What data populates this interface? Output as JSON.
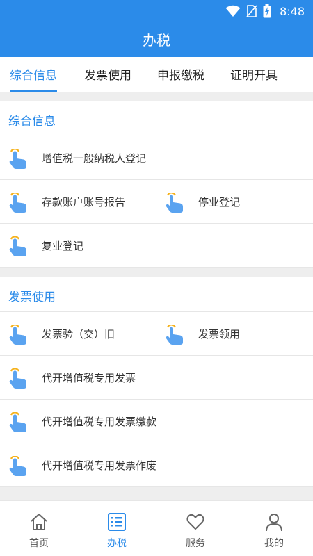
{
  "status": {
    "time": "8:48"
  },
  "header": {
    "title": "办税"
  },
  "tabs": [
    {
      "label": "综合信息",
      "active": true
    },
    {
      "label": "发票使用",
      "active": false
    },
    {
      "label": "申报缴税",
      "active": false
    },
    {
      "label": "证明开具",
      "active": false
    }
  ],
  "sections": [
    {
      "title": "综合信息",
      "items": [
        {
          "label": "增值税一般纳税人登记"
        },
        {
          "label": "存款账户账号报告"
        },
        {
          "label": "停业登记"
        },
        {
          "label": "复业登记"
        }
      ]
    },
    {
      "title": "发票使用",
      "items": [
        {
          "label": "发票验（交）旧"
        },
        {
          "label": "发票领用"
        },
        {
          "label": "代开增值税专用发票"
        },
        {
          "label": "代开增值税专用发票缴款"
        },
        {
          "label": "代开增值税专用发票作废"
        }
      ]
    }
  ],
  "bottom_nav": [
    {
      "label": "首页",
      "icon": "home-icon",
      "active": false
    },
    {
      "label": "办税",
      "icon": "list-icon",
      "active": true
    },
    {
      "label": "服务",
      "icon": "heart-icon",
      "active": false
    },
    {
      "label": "我的",
      "icon": "person-icon",
      "active": false
    }
  ],
  "colors": {
    "primary": "#2b8be9",
    "divider": "#eeeeee",
    "hand_icon": "#5aa3f0",
    "hand_accent": "#f5b21c"
  }
}
